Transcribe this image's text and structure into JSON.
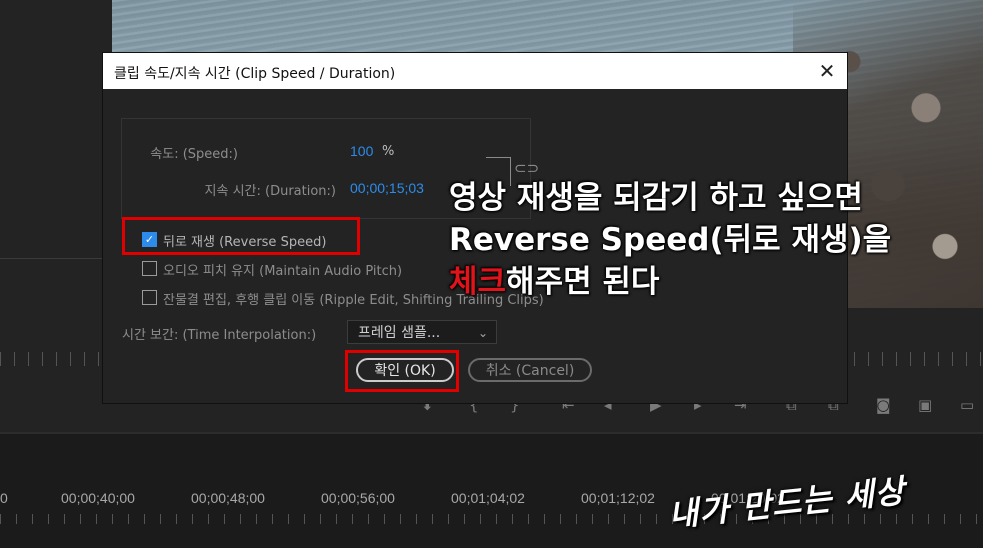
{
  "dialog": {
    "title": "클립 속도/지속 시간 (Clip Speed / Duration)",
    "close_glyph": "✕",
    "speed_label": "속도: (Speed:)",
    "speed_value": "100",
    "speed_unit": "%",
    "duration_label": "지속 시간: (Duration:)",
    "duration_value": "00;00;15;03",
    "reverse_speed": {
      "label": "뒤로 재생 (Reverse Speed)",
      "checked": true
    },
    "maintain_pitch": {
      "label": "오디오 피치 유지 (Maintain Audio Pitch)",
      "checked": false
    },
    "ripple_edit": {
      "label": "잔물결 편집, 후행 클립 이동 (Ripple Edit, Shifting Trailing Clips)",
      "checked": false
    },
    "interpolation_label": "시간 보간: (Time Interpolation:)",
    "interpolation_value": "프레임 샘플...",
    "ok_label": "확인 (OK)",
    "cancel_label": "취소 (Cancel)"
  },
  "annotation": {
    "line1": "영상 재생을 되감기 하고 싶으면",
    "line2": "Reverse Speed(뒤로 재생)을",
    "line3_red": "체크",
    "line3_white": "해주면 된다"
  },
  "timeline": {
    "timecodes": [
      "0",
      "00;00;40;00",
      "00;00;48;00",
      "00;00;56;00",
      "00;01;04;02",
      "00;01;12;02",
      "00;01;20;02"
    ]
  },
  "watermark": "내가 만드는 세상",
  "colors": {
    "accent": "#2d8ceb",
    "highlight_red": "#e00000",
    "annotation_red": "#e2131b"
  }
}
